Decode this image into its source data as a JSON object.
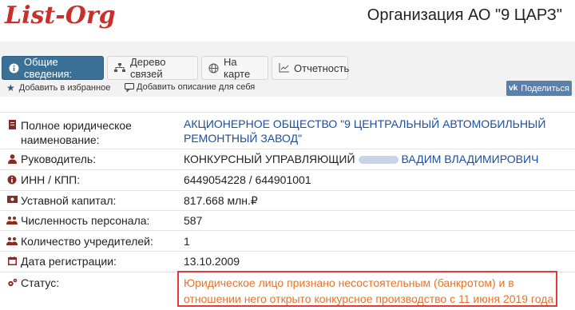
{
  "header": {
    "logo": "List-Org",
    "title": "Организация АО \"9 ЦАРЗ\""
  },
  "tabs": [
    {
      "label": "Общие сведения:",
      "icon": "info-icon",
      "active": true
    },
    {
      "label": "Дерево связей",
      "icon": "sitemap-icon",
      "active": false
    },
    {
      "label": "На карте",
      "icon": "globe-icon",
      "active": false
    },
    {
      "label": "Отчетность",
      "icon": "chart-icon",
      "active": false
    }
  ],
  "actions": {
    "favorite": "Добавить в избранное",
    "describe": "Добавить описание для себя",
    "share": "Поделиться"
  },
  "details": {
    "full_name_label": "Полное юридическое наименование:",
    "full_name_value": "АКЦИОНЕРНОЕ ОБЩЕСТВО \"9 ЦЕНТРАЛЬНЫЙ АВТОМОБИЛЬНЫЙ РЕМОНТНЫЙ ЗАВОД\"",
    "manager_label": "Руководитель:",
    "manager_prefix": "КОНКУРСНЫЙ УПРАВЛЯЮЩИЙ",
    "manager_name": "ВАДИМ ВЛАДИМИРОВИЧ",
    "inn_label": "ИНН / КПП:",
    "inn_value": "6449054228 / 644901001",
    "capital_label": "Уставной капитал:",
    "capital_value": "817.668 млн.₽",
    "staff_label": "Численность персонала:",
    "staff_value": "587",
    "founders_label": "Количество учредителей:",
    "founders_value": "1",
    "reg_label": "Дата регистрации:",
    "reg_value": "13.10.2009",
    "status_label": "Статус:",
    "status_value": "Юридическое лицо признано несостоятельным (банкротом) и в отношении него открыто конкурсное производство с 11 июня 2019 года"
  },
  "colors": {
    "brand": "#c9302c",
    "active_tab": "#3a6f96",
    "link": "#1a4fa3",
    "status_text": "#e8732a",
    "status_border": "#e53935"
  }
}
